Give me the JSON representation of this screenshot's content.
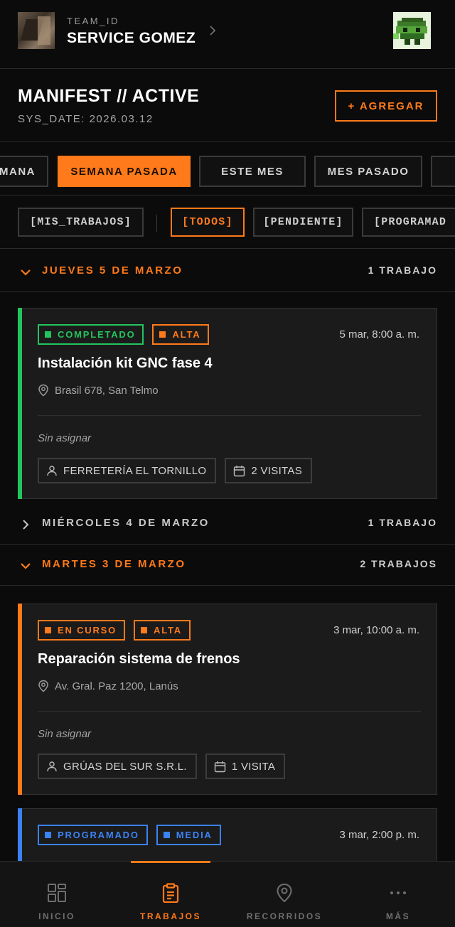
{
  "header": {
    "team_label": "TEAM_ID",
    "team_name": "SERVICE GOMEZ"
  },
  "manifest": {
    "title": "MANIFEST // ACTIVE",
    "sys_date": "SYS_DATE: 2026.03.12",
    "add_label": "+ AGREGAR"
  },
  "period_tabs": [
    {
      "label": "MANA"
    },
    {
      "label": "SEMANA PASADA",
      "active": true
    },
    {
      "label": "ESTE MES"
    },
    {
      "label": "MES PASADO"
    }
  ],
  "filter_tabs": [
    {
      "label": "[MIS_TRABAJOS]"
    },
    {
      "label": "[TODOS]",
      "active": true
    },
    {
      "label": "[PENDIENTE]"
    },
    {
      "label": "[PROGRAMAD"
    }
  ],
  "days": [
    {
      "title": "JUEVES 5 DE MARZO",
      "count": "1 TRABAJO",
      "open": true
    },
    {
      "title": "MIÉRCOLES 4 DE MARZO",
      "count": "1 TRABAJO",
      "open": false
    },
    {
      "title": "MARTES 3 DE MARZO",
      "count": "2 TRABAJOS",
      "open": true
    }
  ],
  "jobs": [
    {
      "status": "COMPLETADO",
      "priority": "ALTA",
      "time": "5 mar, 8:00 a. m.",
      "title": "Instalación kit GNC fase 4",
      "address": "Brasil 678, San Telmo",
      "assignee": "Sin asignar",
      "client": "FERRETERÍA EL TORNILLO",
      "visits": "2 VISITAS",
      "status_color": "#22c55e"
    },
    {
      "status": "EN CURSO",
      "priority": "ALTA",
      "time": "3 mar, 10:00 a. m.",
      "title": "Reparación sistema de frenos",
      "address": "Av. Gral. Paz 1200, Lanús",
      "assignee": "Sin asignar",
      "client": "GRÚAS DEL SUR S.R.L.",
      "visits": "1 VISITA",
      "status_color": "#ff7a1a"
    },
    {
      "status": "PROGRAMADO",
      "priority": "MEDIA",
      "time": "3 mar, 2:00 p. m.",
      "status_color": "#3b82f6"
    }
  ],
  "nav": [
    {
      "label": "INICIO",
      "icon": "grid-icon"
    },
    {
      "label": "TRABAJOS",
      "icon": "clipboard-icon",
      "active": true
    },
    {
      "label": "RECORRIDOS",
      "icon": "map-pin-icon"
    },
    {
      "label": "MÁS",
      "icon": "more-icon"
    }
  ],
  "colors": {
    "accent": "#ff7a1a",
    "completed": "#22c55e",
    "in_progress": "#ff7a1a",
    "scheduled": "#3b82f6",
    "background": "#0b0b0b"
  }
}
